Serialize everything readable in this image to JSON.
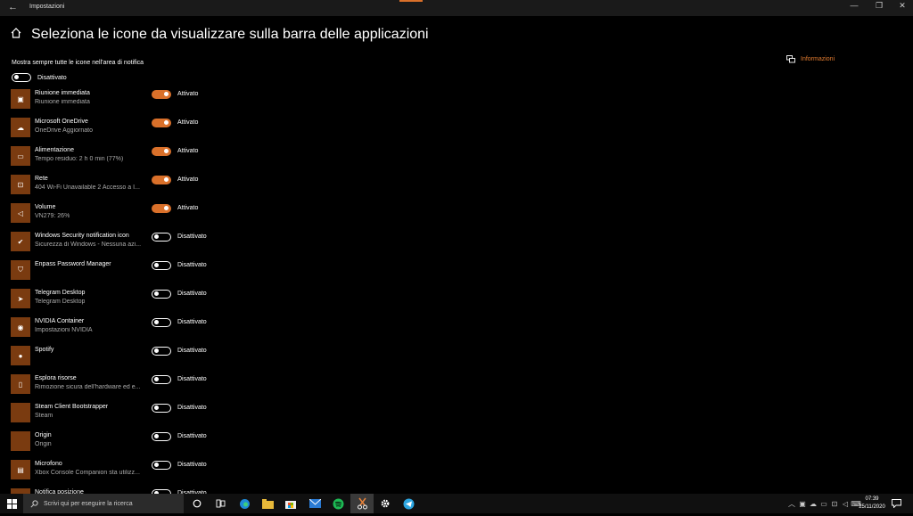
{
  "window": {
    "title": "Impostazioni",
    "back_glyph": "←",
    "controls": {
      "minimize": "—",
      "maximize": "❐",
      "close": "✕"
    }
  },
  "page": {
    "title": "Seleziona le icone da visualizzare sulla barra delle applicazioni",
    "info_link": "Informazioni"
  },
  "master": {
    "label": "Mostra sempre tutte le icone nell'area di notifica",
    "state": "Disattivato",
    "on": false
  },
  "items": [
    {
      "name": "Riunione immediata",
      "sub": "Riunione immediata",
      "state": "Attivato",
      "on": true,
      "icon": "meet-now-icon",
      "glyph": "▣"
    },
    {
      "name": "Microsoft OneDrive",
      "sub": "OneDrive Aggiornato",
      "state": "Attivato",
      "on": true,
      "icon": "cloud-icon",
      "glyph": "☁"
    },
    {
      "name": "Alimentazione",
      "sub": "Tempo residuo: 2 h 0 min (77%)",
      "state": "Attivato",
      "on": true,
      "icon": "battery-icon",
      "glyph": "▭"
    },
    {
      "name": "Rete",
      "sub": "404 Wi-Fi Unavailable 2 Accesso a I...",
      "state": "Attivato",
      "on": true,
      "icon": "network-icon",
      "glyph": "⊡"
    },
    {
      "name": "Volume",
      "sub": "VN279: 26%",
      "state": "Attivato",
      "on": true,
      "icon": "speaker-icon",
      "glyph": "◁"
    },
    {
      "name": "Windows Security notification icon",
      "sub": "Sicurezza di Windows - Nessuna azi...",
      "state": "Disattivato",
      "on": false,
      "icon": "windows-security-icon",
      "glyph": "✔"
    },
    {
      "name": "Enpass Password Manager",
      "sub": "",
      "state": "Disattivato",
      "on": false,
      "icon": "enpass-icon",
      "glyph": "⛉"
    },
    {
      "name": "Telegram Desktop",
      "sub": "Telegram Desktop",
      "state": "Disattivato",
      "on": false,
      "icon": "telegram-icon",
      "glyph": "➤"
    },
    {
      "name": "NVIDIA Container",
      "sub": "Impostazioni NVIDIA",
      "state": "Disattivato",
      "on": false,
      "icon": "nvidia-icon",
      "glyph": "◉"
    },
    {
      "name": "Spotify",
      "sub": "",
      "state": "Disattivato",
      "on": false,
      "icon": "spotify-icon",
      "glyph": "●"
    },
    {
      "name": "Esplora risorse",
      "sub": "Rimozione sicura dell'hardware ed e...",
      "state": "Disattivato",
      "on": false,
      "icon": "usb-eject-icon",
      "glyph": "▯"
    },
    {
      "name": "Steam Client Bootstrapper",
      "sub": "Steam",
      "state": "Disattivato",
      "on": false,
      "icon": "steam-icon",
      "glyph": ""
    },
    {
      "name": "Origin",
      "sub": "Origin",
      "state": "Disattivato",
      "on": false,
      "icon": "origin-icon",
      "glyph": ""
    },
    {
      "name": "Microfono",
      "sub": "Xbox Console Companion sta utilizz...",
      "state": "Disattivato",
      "on": false,
      "icon": "xbox-icon",
      "glyph": "▤"
    },
    {
      "name": "Notifica posizione",
      "sub": "",
      "state": "Disattivato",
      "on": false,
      "icon": "location-icon",
      "glyph": ""
    }
  ],
  "taskbar": {
    "search_placeholder": "Scrivi qui per eseguire la ricerca",
    "clock_time": "07:39",
    "clock_date": "25/11/2020",
    "accent_color": "#d9702a"
  }
}
